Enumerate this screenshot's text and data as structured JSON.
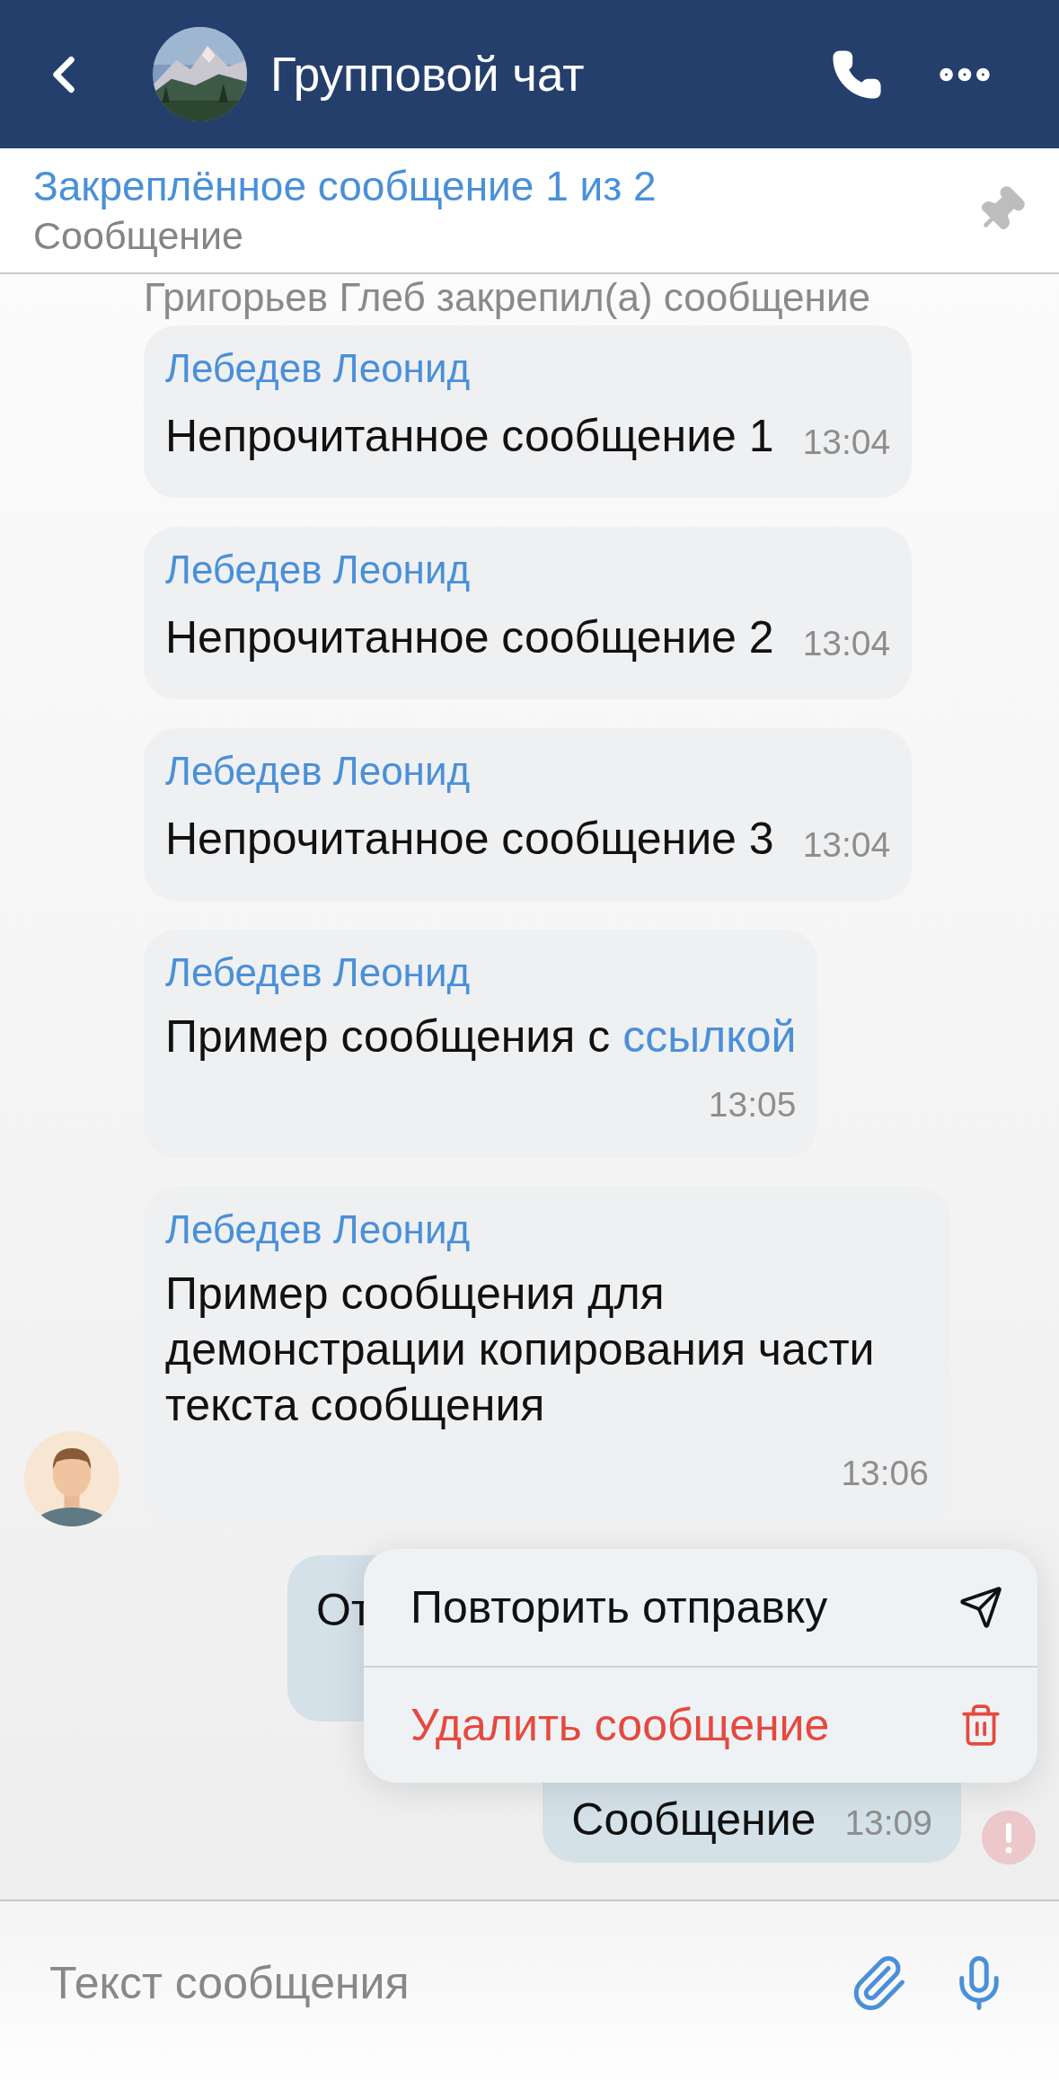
{
  "header": {
    "title": "Групповой чат"
  },
  "pinned": {
    "title": "Закреплённое сообщение 1 из 2",
    "text": "Сообщение"
  },
  "messages": [
    {
      "kind": "system",
      "text": "Григорьев Глеб закрепил(а) сообщение"
    },
    {
      "kind": "incoming",
      "author": "Лебедев Леонид",
      "text": "Непрочитанное сообщение 1",
      "time": "13:04",
      "time_below": false,
      "avatar": false
    },
    {
      "kind": "incoming",
      "author": "Лебедев Леонид",
      "text": "Непрочитанное сообщение 2",
      "time": "13:04",
      "time_below": false,
      "avatar": false
    },
    {
      "kind": "incoming",
      "author": "Лебедев Леонид",
      "text": "Непрочитанное сообщение 3",
      "time": "13:04",
      "time_below": false,
      "avatar": false
    },
    {
      "kind": "incoming",
      "author": "Лебедев Леонид",
      "text": "Пример сообщения с",
      "link": "ссылкой",
      "time": "13:05",
      "time_below": true,
      "avatar": false
    },
    {
      "kind": "incoming",
      "author": "Лебедев Леонид",
      "text": "Пример сообщения для демонстрации копирования части текста сообщения",
      "time": "13:06",
      "time_below": true,
      "avatar": true
    },
    {
      "kind": "outgoing_hidden",
      "text": "От"
    },
    {
      "kind": "outgoing",
      "text": "Сообщение",
      "time": "13:09",
      "failed": true
    }
  ],
  "context_menu": [
    {
      "kind": "retry",
      "label": "Повторить отправку",
      "destructive": false
    },
    {
      "kind": "delete",
      "label": "Удалить сообщение",
      "destructive": true
    }
  ],
  "composer": {
    "placeholder": "Текст сообщения"
  }
}
